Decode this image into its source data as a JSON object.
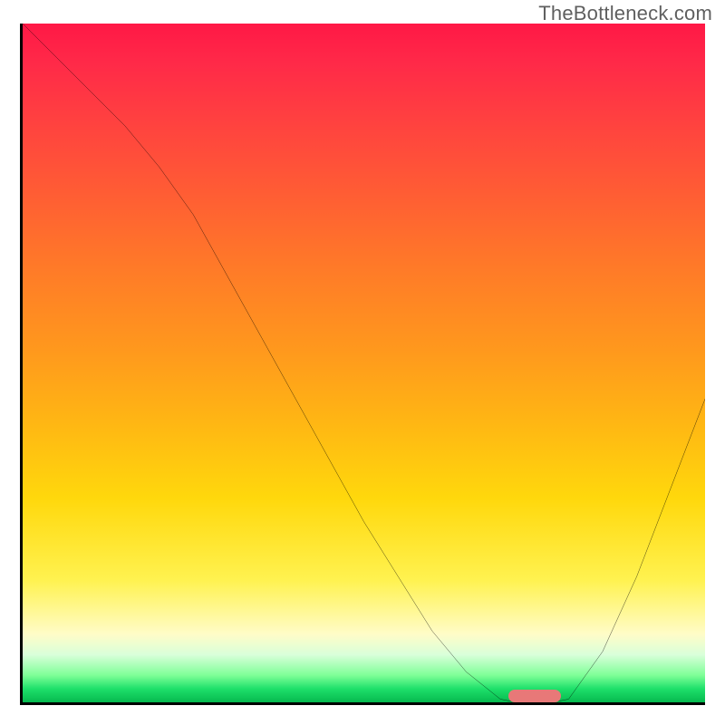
{
  "watermark": "TheBottleneck.com",
  "marker": {
    "x_pct": 75,
    "y_pct": 99.1,
    "color": "#e87878"
  },
  "axes": {
    "color": "#000000"
  },
  "chart_data": {
    "type": "line",
    "title": "",
    "xlabel": "",
    "ylabel": "",
    "xlim": [
      0,
      100
    ],
    "ylim": [
      0,
      100
    ],
    "series": [
      {
        "name": "curve",
        "x": [
          0,
          5,
          10,
          15,
          20,
          25,
          30,
          35,
          40,
          45,
          50,
          55,
          60,
          65,
          70,
          75,
          80,
          85,
          90,
          95,
          100
        ],
        "y": [
          100,
          95,
          90,
          85,
          79,
          72,
          63,
          54,
          45,
          36,
          27,
          19,
          11,
          5,
          1,
          0,
          1,
          8,
          19,
          32,
          45
        ]
      }
    ],
    "background_gradient": [
      "#ff1846",
      "#ff5a35",
      "#ff981d",
      "#ffd80c",
      "#fff250",
      "#fffcc8",
      "#7fff97",
      "#06b94f"
    ],
    "optimum_x": 75
  }
}
